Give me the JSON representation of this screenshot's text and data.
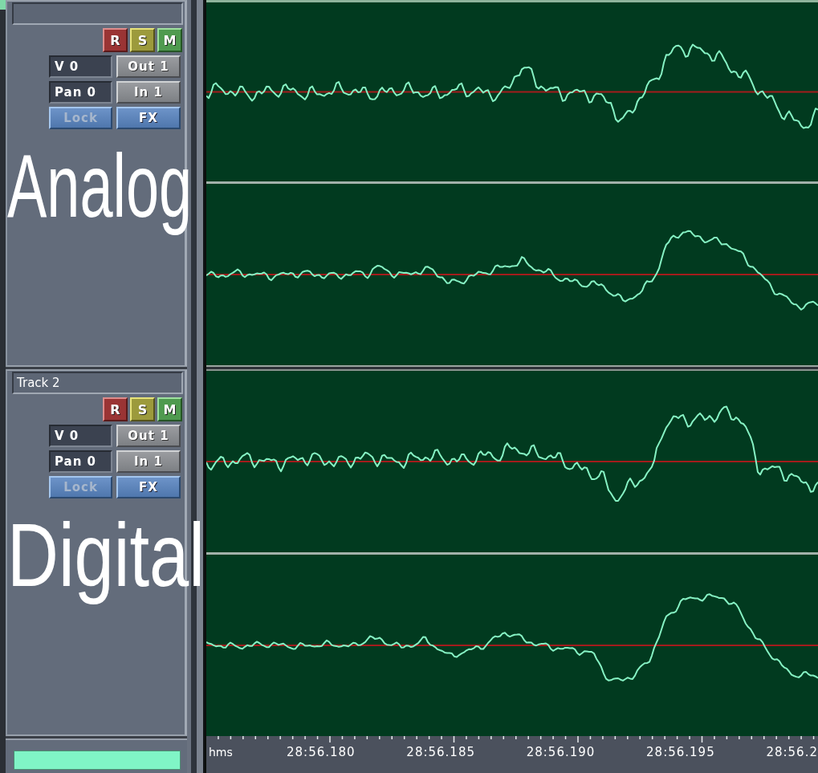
{
  "tracks": [
    {
      "overlay_label": "Analog",
      "buttons": [
        {
          "label": "R",
          "kind": "record"
        },
        {
          "label": "S",
          "kind": "solo"
        },
        {
          "label": "M",
          "kind": "mute"
        }
      ],
      "volume": "V 0",
      "output": "Out 1",
      "pan": "Pan 0",
      "input": "In 1",
      "toggles": [
        {
          "label": "Lock",
          "disabled": true
        },
        {
          "label": "FX",
          "disabled": false
        }
      ]
    },
    {
      "name": "Track 2",
      "overlay_label": "Digital",
      "buttons": [
        {
          "label": "R",
          "kind": "record"
        },
        {
          "label": "S",
          "kind": "solo"
        },
        {
          "label": "M",
          "kind": "mute"
        }
      ],
      "volume": "V 0",
      "output": "Out 1",
      "pan": "Pan 0",
      "input": "In 1",
      "toggles": [
        {
          "label": "Lock",
          "disabled": true
        },
        {
          "label": "FX",
          "disabled": false
        }
      ]
    }
  ],
  "ruler": {
    "unit": "hms",
    "labels": [
      "28:56.180",
      "28:56.185",
      "28:56.190",
      "28:56.195",
      "28:56.2"
    ]
  }
}
